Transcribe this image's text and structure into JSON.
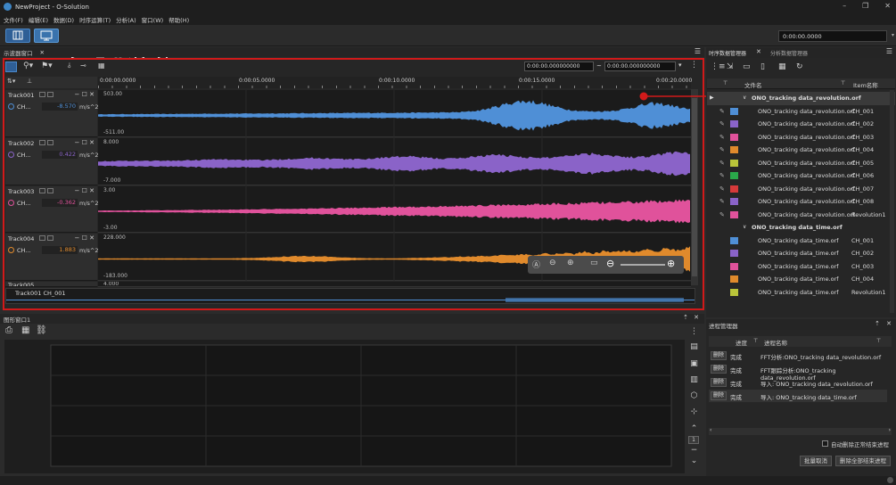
{
  "window": {
    "title": "NewProject - O-Solution",
    "minimize": "–",
    "restore": "❐",
    "close": "✕"
  },
  "menu": [
    "文件(F)",
    "编辑(E)",
    "数据(D)",
    "时序运算(T)",
    "分析(A)",
    "窗口(W)",
    "帮助(H)"
  ],
  "toolbar": {
    "time": "0:00:00.0000"
  },
  "waveform_window": {
    "tab": "示波器窗口",
    "time_start": "0:00:00.000000000",
    "time_sep": "~",
    "time_end": "0:00:00.000000000",
    "ruler": [
      "0:00:00.0000",
      "0:00:05.0000",
      "0:00:10.0000",
      "0:00:15.0000",
      "0:00:20.0000"
    ],
    "tracks": [
      {
        "name": "Track001",
        "channel": "CH...",
        "value": "-8.570",
        "unit": "m/s^2",
        "ymax": "503.00",
        "ymin": "-511.00",
        "color": "#4f8fd6"
      },
      {
        "name": "Track002",
        "channel": "CH...",
        "value": "0.422",
        "unit": "m/s^2",
        "ymax": "8.000",
        "ymin": "-7.000",
        "color": "#8a63c8"
      },
      {
        "name": "Track003",
        "channel": "CH...",
        "value": "-0.362",
        "unit": "m/s^2",
        "ymax": "3.00",
        "ymin": "-3.00",
        "color": "#e0529b"
      },
      {
        "name": "Track004",
        "channel": "CH...",
        "value": "1.883",
        "unit": "m/s^2",
        "ymax": "228.000",
        "ymin": "-183.000",
        "color": "#e08a2c"
      }
    ],
    "partial_track": {
      "name": "Track005",
      "ymax": "4.000"
    },
    "overview_label": "Track001 CH_001",
    "track_btns": "− ☐ ✕"
  },
  "graph_window": {
    "tab": "图形窗口1",
    "page_num": "1"
  },
  "data_manager": {
    "tabs": [
      "时序数据管理器",
      "分析数据管理器"
    ],
    "col_filename": "文件名",
    "col_item": "Item名称",
    "groups": [
      {
        "name": "ONO_tracking data_revolution.orf",
        "rows": [
          {
            "file": "ONO_tracking data_revolution.orf",
            "item": "CH_001",
            "color": "#4f8fd6"
          },
          {
            "file": "ONO_tracking data_revolution.orf",
            "item": "CH_002",
            "color": "#8a63c8"
          },
          {
            "file": "ONO_tracking data_revolution.orf",
            "item": "CH_003",
            "color": "#e0529b"
          },
          {
            "file": "ONO_tracking data_revolution.orf",
            "item": "CH_004",
            "color": "#e08a2c"
          },
          {
            "file": "ONO_tracking data_revolution.orf",
            "item": "CH_005",
            "color": "#b9c43a"
          },
          {
            "file": "ONO_tracking data_revolution.orf",
            "item": "CH_006",
            "color": "#2aa84a"
          },
          {
            "file": "ONO_tracking data_revolution.orf",
            "item": "CH_007",
            "color": "#d63a3a"
          },
          {
            "file": "ONO_tracking data_revolution.orf",
            "item": "CH_008",
            "color": "#8a63c8"
          },
          {
            "file": "ONO_tracking data_revolution.orf",
            "item": "Revolution1",
            "color": "#e0529b"
          }
        ]
      },
      {
        "name": "ONO_tracking data_time.orf",
        "rows": [
          {
            "file": "ONO_tracking data_time.orf",
            "item": "CH_001",
            "color": "#4f8fd6"
          },
          {
            "file": "ONO_tracking data_time.orf",
            "item": "CH_002",
            "color": "#8a63c8"
          },
          {
            "file": "ONO_tracking data_time.orf",
            "item": "CH_003",
            "color": "#e0529b"
          },
          {
            "file": "ONO_tracking data_time.orf",
            "item": "CH_004",
            "color": "#e08a2c"
          },
          {
            "file": "ONO_tracking data_time.orf",
            "item": "Revolution1",
            "color": "#b9c43a"
          }
        ]
      }
    ]
  },
  "process_manager": {
    "title": "进程管理器",
    "col_progress": "进度",
    "col_name": "进程名称",
    "delete_label": "删除",
    "rows": [
      {
        "status": "完成",
        "name": "FFT分析:ONO_tracking data_revolution.orf"
      },
      {
        "status": "完成",
        "name": "FFT跟踪分析:ONO_tracking data_revolution.orf"
      },
      {
        "status": "完成",
        "name": "导入: ONO_tracking data_revolution.orf"
      },
      {
        "status": "完成",
        "name": "导入: ONO_tracking data_time.orf"
      }
    ],
    "auto_delete_label": "自动删除正常结束进程",
    "btn_batch_cancel": "批量取消",
    "btn_delete_all": "删除全部结束进程"
  }
}
